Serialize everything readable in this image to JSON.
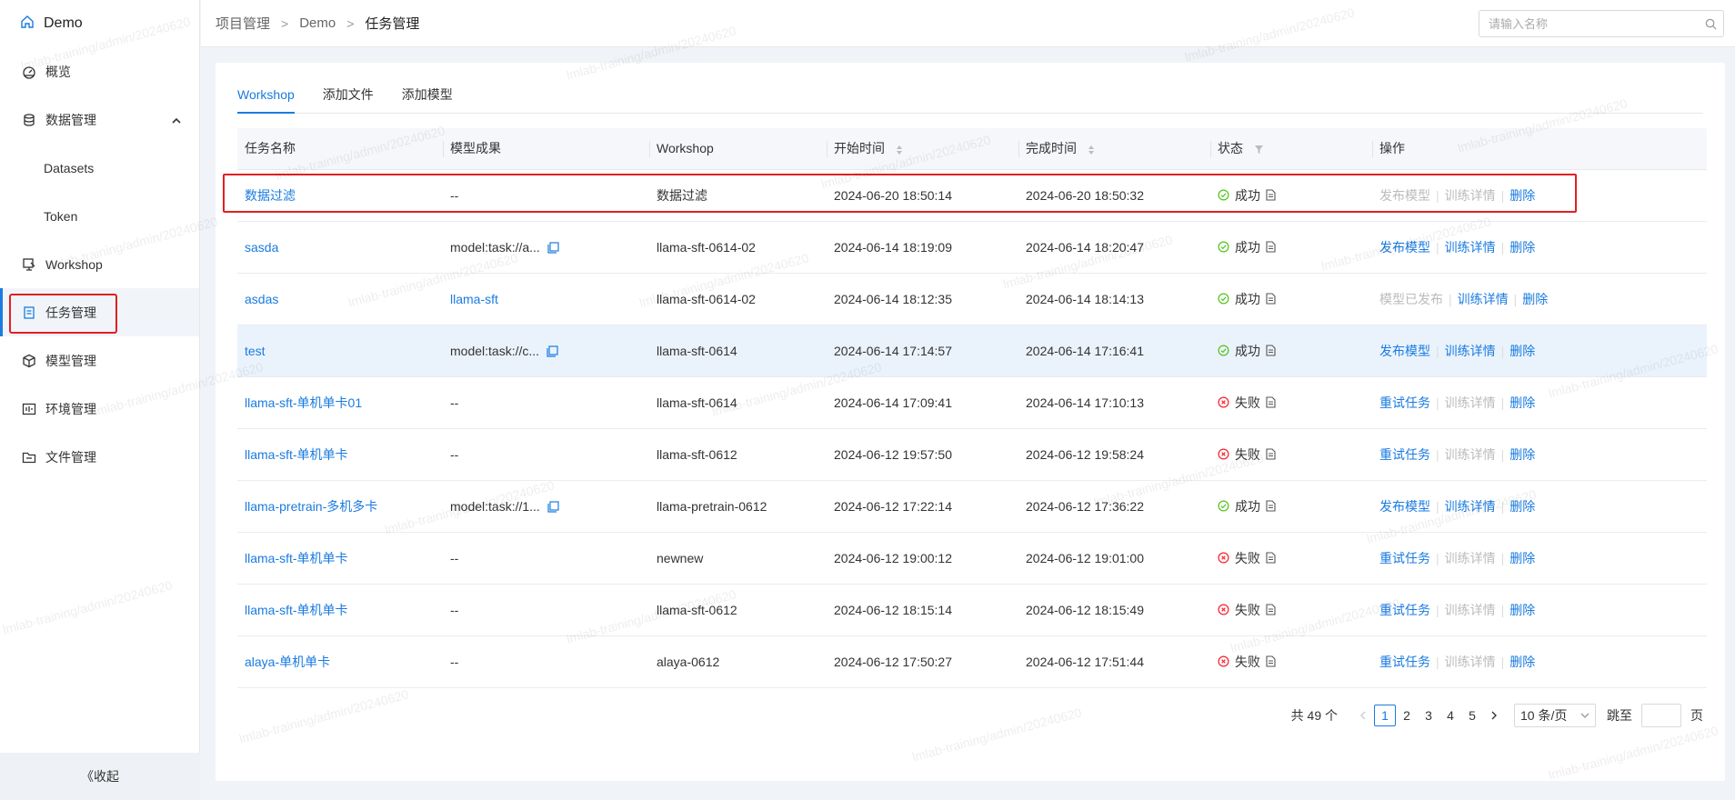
{
  "sidebar": {
    "brand": "Demo",
    "items": [
      {
        "label": "概览"
      },
      {
        "label": "数据管理"
      },
      {
        "label": "Datasets"
      },
      {
        "label": "Token"
      },
      {
        "label": "Workshop"
      },
      {
        "label": "任务管理"
      },
      {
        "label": "模型管理"
      },
      {
        "label": "环境管理"
      },
      {
        "label": "文件管理"
      }
    ],
    "collapse": "《收起"
  },
  "header": {
    "breadcrumb": [
      "项目管理",
      "Demo",
      "任务管理"
    ],
    "sep": ">",
    "search_placeholder": "请输入名称"
  },
  "tabs": [
    "Workshop",
    "添加文件",
    "添加模型"
  ],
  "table": {
    "columns": [
      "任务名称",
      "模型成果",
      "Workshop",
      "开始时间",
      "完成时间",
      "状态",
      "操作"
    ],
    "rows": [
      {
        "name": "数据过滤",
        "model": "--",
        "workshop": "数据过滤",
        "start": "2024-06-20 18:50:14",
        "end": "2024-06-20 18:50:32",
        "status": "成功",
        "op1": "发布模型",
        "op2": "训练详情",
        "op3": "删除"
      },
      {
        "name": "sasda",
        "model": "model:task://a...",
        "workshop": "llama-sft-0614-02",
        "start": "2024-06-14 18:19:09",
        "end": "2024-06-14 18:20:47",
        "status": "成功",
        "op1": "发布模型",
        "op2": "训练详情",
        "op3": "删除"
      },
      {
        "name": "asdas",
        "model": "llama-sft",
        "workshop": "llama-sft-0614-02",
        "start": "2024-06-14 18:12:35",
        "end": "2024-06-14 18:14:13",
        "status": "成功",
        "op1": "模型已发布",
        "op2": "训练详情",
        "op3": "删除"
      },
      {
        "name": "test",
        "model": "model:task://c...",
        "workshop": "llama-sft-0614",
        "start": "2024-06-14 17:14:57",
        "end": "2024-06-14 17:16:41",
        "status": "成功",
        "op1": "发布模型",
        "op2": "训练详情",
        "op3": "删除"
      },
      {
        "name": "llama-sft-单机单卡01",
        "model": "--",
        "workshop": "llama-sft-0614",
        "start": "2024-06-14 17:09:41",
        "end": "2024-06-14 17:10:13",
        "status": "失败",
        "op1": "重试任务",
        "op2": "训练详情",
        "op3": "删除"
      },
      {
        "name": "llama-sft-单机单卡",
        "model": "--",
        "workshop": "llama-sft-0612",
        "start": "2024-06-12 19:57:50",
        "end": "2024-06-12 19:58:24",
        "status": "失败",
        "op1": "重试任务",
        "op2": "训练详情",
        "op3": "删除"
      },
      {
        "name": "llama-pretrain-多机多卡",
        "model": "model:task://1...",
        "workshop": "llama-pretrain-0612",
        "start": "2024-06-12 17:22:14",
        "end": "2024-06-12 17:36:22",
        "status": "成功",
        "op1": "发布模型",
        "op2": "训练详情",
        "op3": "删除"
      },
      {
        "name": "llama-sft-单机单卡",
        "model": "--",
        "workshop": "newnew",
        "start": "2024-06-12 19:00:12",
        "end": "2024-06-12 19:01:00",
        "status": "失败",
        "op1": "重试任务",
        "op2": "训练详情",
        "op3": "删除"
      },
      {
        "name": "llama-sft-单机单卡",
        "model": "--",
        "workshop": "llama-sft-0612",
        "start": "2024-06-12 18:15:14",
        "end": "2024-06-12 18:15:49",
        "status": "失败",
        "op1": "重试任务",
        "op2": "训练详情",
        "op3": "删除"
      },
      {
        "name": "alaya-单机单卡",
        "model": "--",
        "workshop": "alaya-0612",
        "start": "2024-06-12 17:50:27",
        "end": "2024-06-12 17:51:44",
        "status": "失败",
        "op1": "重试任务",
        "op2": "训练详情",
        "op3": "删除"
      }
    ]
  },
  "pagination": {
    "total": "共 49 个",
    "pages": [
      "1",
      "2",
      "3",
      "4",
      "5"
    ],
    "page_size": "10 条/页",
    "jump_label": "跳至",
    "page_suffix": "页"
  },
  "watermark": "lmlab-training/admin/20240620",
  "colors": {
    "accent": "#1a7be0",
    "success": "#52c41a",
    "fail": "#f5222d",
    "highlight": "#e02020"
  }
}
